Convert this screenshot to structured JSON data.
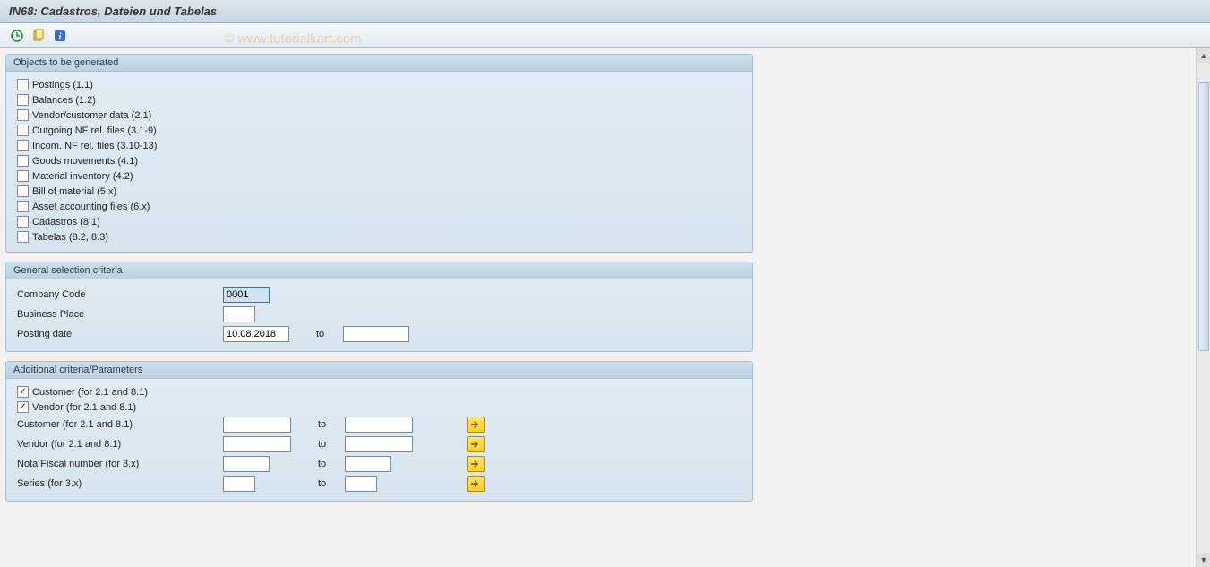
{
  "title": "IN68: Cadastros, Dateien und Tabelas",
  "watermark": "© www.tutorialkart.com",
  "groups": {
    "objects": {
      "title": "Objects to be generated",
      "items": [
        {
          "label": "Postings (1.1)",
          "checked": false
        },
        {
          "label": "Balances (1.2)",
          "checked": false
        },
        {
          "label": "Vendor/customer data (2.1)",
          "checked": false
        },
        {
          "label": "Outgoing NF rel. files (3.1-9)",
          "checked": false
        },
        {
          "label": "Incom. NF rel. files (3.10-13)",
          "checked": false
        },
        {
          "label": "Goods movements (4.1)",
          "checked": false
        },
        {
          "label": "Material inventory (4.2)",
          "checked": false
        },
        {
          "label": "Bill of material (5.x)",
          "checked": false
        },
        {
          "label": "Asset accounting files (6.x)",
          "checked": false
        },
        {
          "label": "Cadastros (8.1)",
          "checked": false
        },
        {
          "label": "Tabelas (8.2, 8.3)",
          "checked": false
        }
      ]
    },
    "general": {
      "title": "General selection criteria",
      "company_code_label": "Company Code",
      "company_code_value": "0001",
      "business_place_label": "Business Place",
      "business_place_value": "",
      "posting_date_label": "Posting date",
      "posting_date_from": "10.08.2018",
      "posting_date_to_label": "to",
      "posting_date_to": ""
    },
    "additional": {
      "title": "Additional criteria/Parameters",
      "chk_customer_label": "Customer  (for 2.1 and 8.1)",
      "chk_customer_checked": true,
      "chk_vendor_label": "Vendor (for 2.1 and 8.1)",
      "chk_vendor_checked": true,
      "to_label": "to",
      "rows": [
        {
          "label": "Customer  (for 2.1 and 8.1)"
        },
        {
          "label": "Vendor (for 2.1 and 8.1)"
        },
        {
          "label": "Nota Fiscal number (for 3.x)"
        },
        {
          "label": "Series (for 3.x)"
        }
      ]
    }
  }
}
